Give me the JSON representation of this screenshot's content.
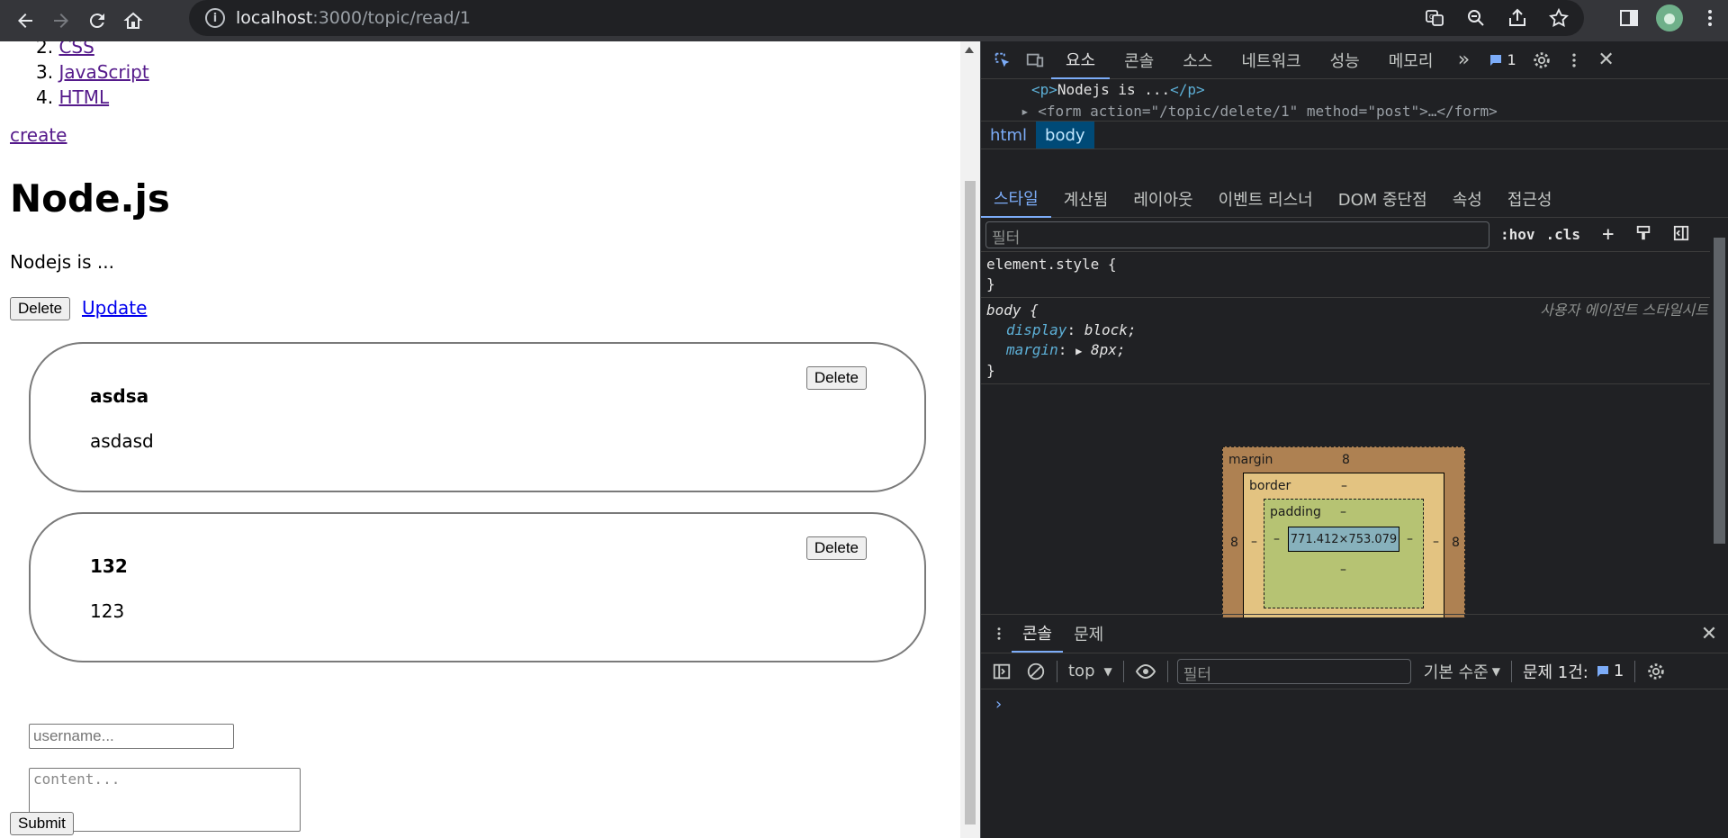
{
  "browser": {
    "url_host": "localhost",
    "url_path": ":3000/topic/read/1"
  },
  "page": {
    "nav_items": [
      {
        "num": "2.",
        "label": "CSS"
      },
      {
        "num": "3.",
        "label": "JavaScript"
      },
      {
        "num": "4.",
        "label": "HTML"
      }
    ],
    "create_label": "create",
    "title": "Node.js",
    "description": "Nodejs is ...",
    "delete_label": "Delete",
    "update_label": "Update",
    "comments": [
      {
        "name": "asdsa",
        "text": "asdasd",
        "delete_label": "Delete"
      },
      {
        "name": "132",
        "text": "123",
        "delete_label": "Delete"
      }
    ],
    "username_placeholder": "username...",
    "content_placeholder": "content...",
    "submit_label": "Submit"
  },
  "devtools": {
    "tabs": [
      "요소",
      "콘솔",
      "소스",
      "네트워크",
      "성능",
      "메모리"
    ],
    "active_tab": "요소",
    "issue_count": "1",
    "dom_line1_open": "<p>",
    "dom_line1_text": "Nodejs is ...",
    "dom_line1_close": "</p>",
    "dom_line2": "▸ <form action=\"/topic/delete/1\" method=\"post\">…</form>",
    "breadcrumbs": [
      "html",
      "body"
    ],
    "sub_tabs": [
      "스타일",
      "계산됨",
      "레이아웃",
      "이벤트 리스너",
      "DOM 중단점",
      "속성",
      "접근성"
    ],
    "filter_placeholder": "필터",
    "hov": ":hov",
    "cls": ".cls",
    "element_style": "element.style {",
    "close_brace": "}",
    "body_selector": "body {",
    "ua_label": "사용자 에이전트 스타일시트",
    "props": [
      {
        "name": "display",
        "value": "block;"
      },
      {
        "name": "margin",
        "value": "8px;"
      }
    ],
    "box_model": {
      "margin_label": "margin",
      "margin_value": "8",
      "border_label": "border",
      "padding_label": "padding",
      "dash": "–",
      "content_size": "771.412×753.079"
    },
    "console_tabs": [
      "콘솔",
      "문제"
    ],
    "console_context": "top",
    "console_filter_placeholder": "필터",
    "log_level": "기본 수준",
    "issues_label": "문제 1건:",
    "issues_count": "1",
    "prompt": "›"
  }
}
